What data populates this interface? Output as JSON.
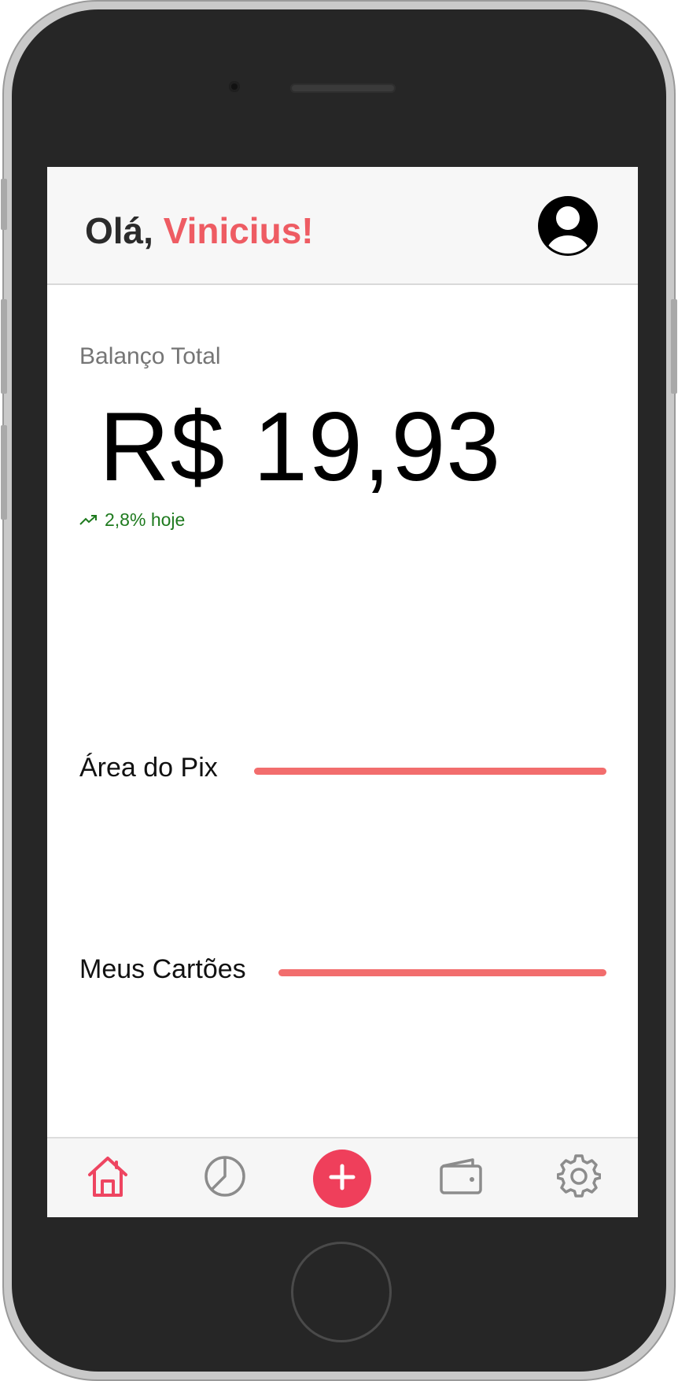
{
  "header": {
    "greeting_prefix": "Olá, ",
    "user_name": "Vinicius!",
    "avatar_icon": "user-circle-icon"
  },
  "balance": {
    "label": "Balanço Total",
    "value": "R$ 19,93",
    "trend_icon": "trending-up-icon",
    "trend_text": "2,8% hoje"
  },
  "sections": {
    "pix_title": "Área do Pix",
    "cards_title": "Meus Cartões"
  },
  "bottom_nav": {
    "items": [
      {
        "icon": "home-icon",
        "active": true
      },
      {
        "icon": "pie-chart-icon",
        "active": false
      },
      {
        "icon": "plus-icon",
        "active": false
      },
      {
        "icon": "wallet-icon",
        "active": false
      },
      {
        "icon": "gear-icon",
        "active": false
      }
    ]
  },
  "colors": {
    "accent": "#ee5c63",
    "fab": "#ef3f5b",
    "trend": "#1e7a1e",
    "section_line": "#f26d6d",
    "nav_inactive": "#8c8c8c"
  }
}
